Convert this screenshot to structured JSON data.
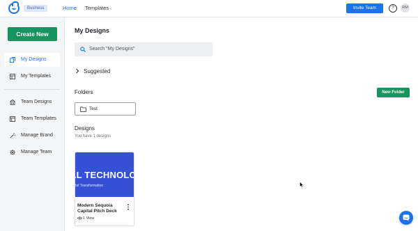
{
  "header": {
    "badge": "Business",
    "tabs": [
      {
        "label": "Home",
        "active": true
      },
      {
        "label": "Templates",
        "active": false
      }
    ],
    "invite_label": "Invite Team",
    "help_glyph": "?",
    "avatar_initials": "RM"
  },
  "sidebar": {
    "create_label": "Create New",
    "items": [
      {
        "label": "My Designs",
        "icon": "copy-icon",
        "active": true
      },
      {
        "label": "My Templates",
        "icon": "template-icon",
        "active": false
      },
      {
        "label": "Team Designs",
        "icon": "building-icon",
        "active": false
      },
      {
        "label": "Team Templates",
        "icon": "layout-icon",
        "active": false
      },
      {
        "label": "Manage Brand",
        "icon": "magic-wand-icon",
        "active": false
      },
      {
        "label": "Manage Team",
        "icon": "gear-icon",
        "active": false
      }
    ]
  },
  "main": {
    "title": "My Designs",
    "search_placeholder": "Search \"My Designs\"",
    "suggested_label": "Suggested",
    "folders_heading": "Folders",
    "new_folder_label": "New Folder",
    "folders": [
      {
        "name": "Test"
      }
    ],
    "designs_heading": "Designs",
    "designs_count_text": "You have 1 designs",
    "designs": [
      {
        "thumb_title": "AL TECHNOLOG",
        "thumb_subtitle": "tal Transformation",
        "name": "Modern Sequoia Capital Pitch Deck",
        "views": "1 View"
      }
    ]
  },
  "colors": {
    "primary": "#1a73e8",
    "green": "#16955f",
    "thumb_bg": "#3551d6"
  }
}
